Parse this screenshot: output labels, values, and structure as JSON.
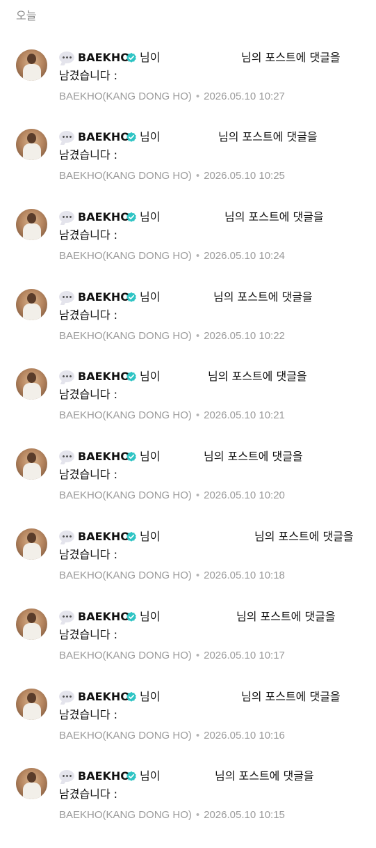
{
  "section_header": "오늘",
  "notification_template": {
    "username": "BAEKHO",
    "suffix": "님이",
    "tail": "님의 포스트에 댓글을",
    "line2": "남겼습니다 :",
    "author": "BAEKHO(KANG DONG HO)",
    "separator": "•",
    "icon": "speech-bubble-icon",
    "badge_icon": "verified-badge-icon",
    "badge_color": "#2ec4c4"
  },
  "notifications": [
    {
      "time": "2026.05.10 10:27"
    },
    {
      "time": "2026.05.10 10:25"
    },
    {
      "time": "2026.05.10 10:24"
    },
    {
      "time": "2026.05.10 10:22"
    },
    {
      "time": "2026.05.10 10:21"
    },
    {
      "time": "2026.05.10 10:20"
    },
    {
      "time": "2026.05.10 10:18"
    },
    {
      "time": "2026.05.10 10:17"
    },
    {
      "time": "2026.05.10 10:16"
    },
    {
      "time": "2026.05.10 10:15"
    }
  ]
}
